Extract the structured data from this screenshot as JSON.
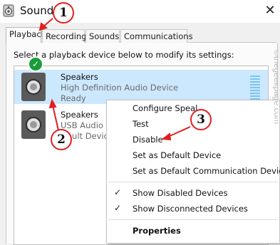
{
  "window": {
    "title": "Sound",
    "close_glyph": "✕"
  },
  "tabs": [
    "Playback",
    "Recording",
    "Sounds",
    "Communications"
  ],
  "instruction": "Select a playback device below to modify its settings:",
  "devices": [
    {
      "name": "Speakers",
      "description": "High Definition Audio Device",
      "status": "Ready"
    },
    {
      "name": "Speakers",
      "description": "USB Audio D",
      "status": "ault Device"
    }
  ],
  "context_menu": {
    "items": [
      {
        "label": "Configure Speal",
        "checked": false
      },
      {
        "label": "Test",
        "checked": false
      },
      {
        "label": "Disable",
        "checked": false
      },
      {
        "label": "Set as Default Device",
        "checked": false
      },
      {
        "label": "Set as Default Communication Device",
        "checked": false
      },
      {
        "label": "Show Disabled Devices",
        "checked": true
      },
      {
        "label": "Show Disconnected Devices",
        "checked": true
      },
      {
        "label": "Properties",
        "checked": false
      }
    ],
    "check_glyph": "✓"
  },
  "callouts": [
    "1",
    "2",
    "3"
  ],
  "watermark": "©thegeekpage.com",
  "colors": {
    "selection": "#cce8ff",
    "callout_border": "#e02020",
    "arrow": "#e02020"
  },
  "icons": {
    "app": "speaker-app-icon",
    "device": "speaker-icon",
    "default": "green-check-icon"
  }
}
